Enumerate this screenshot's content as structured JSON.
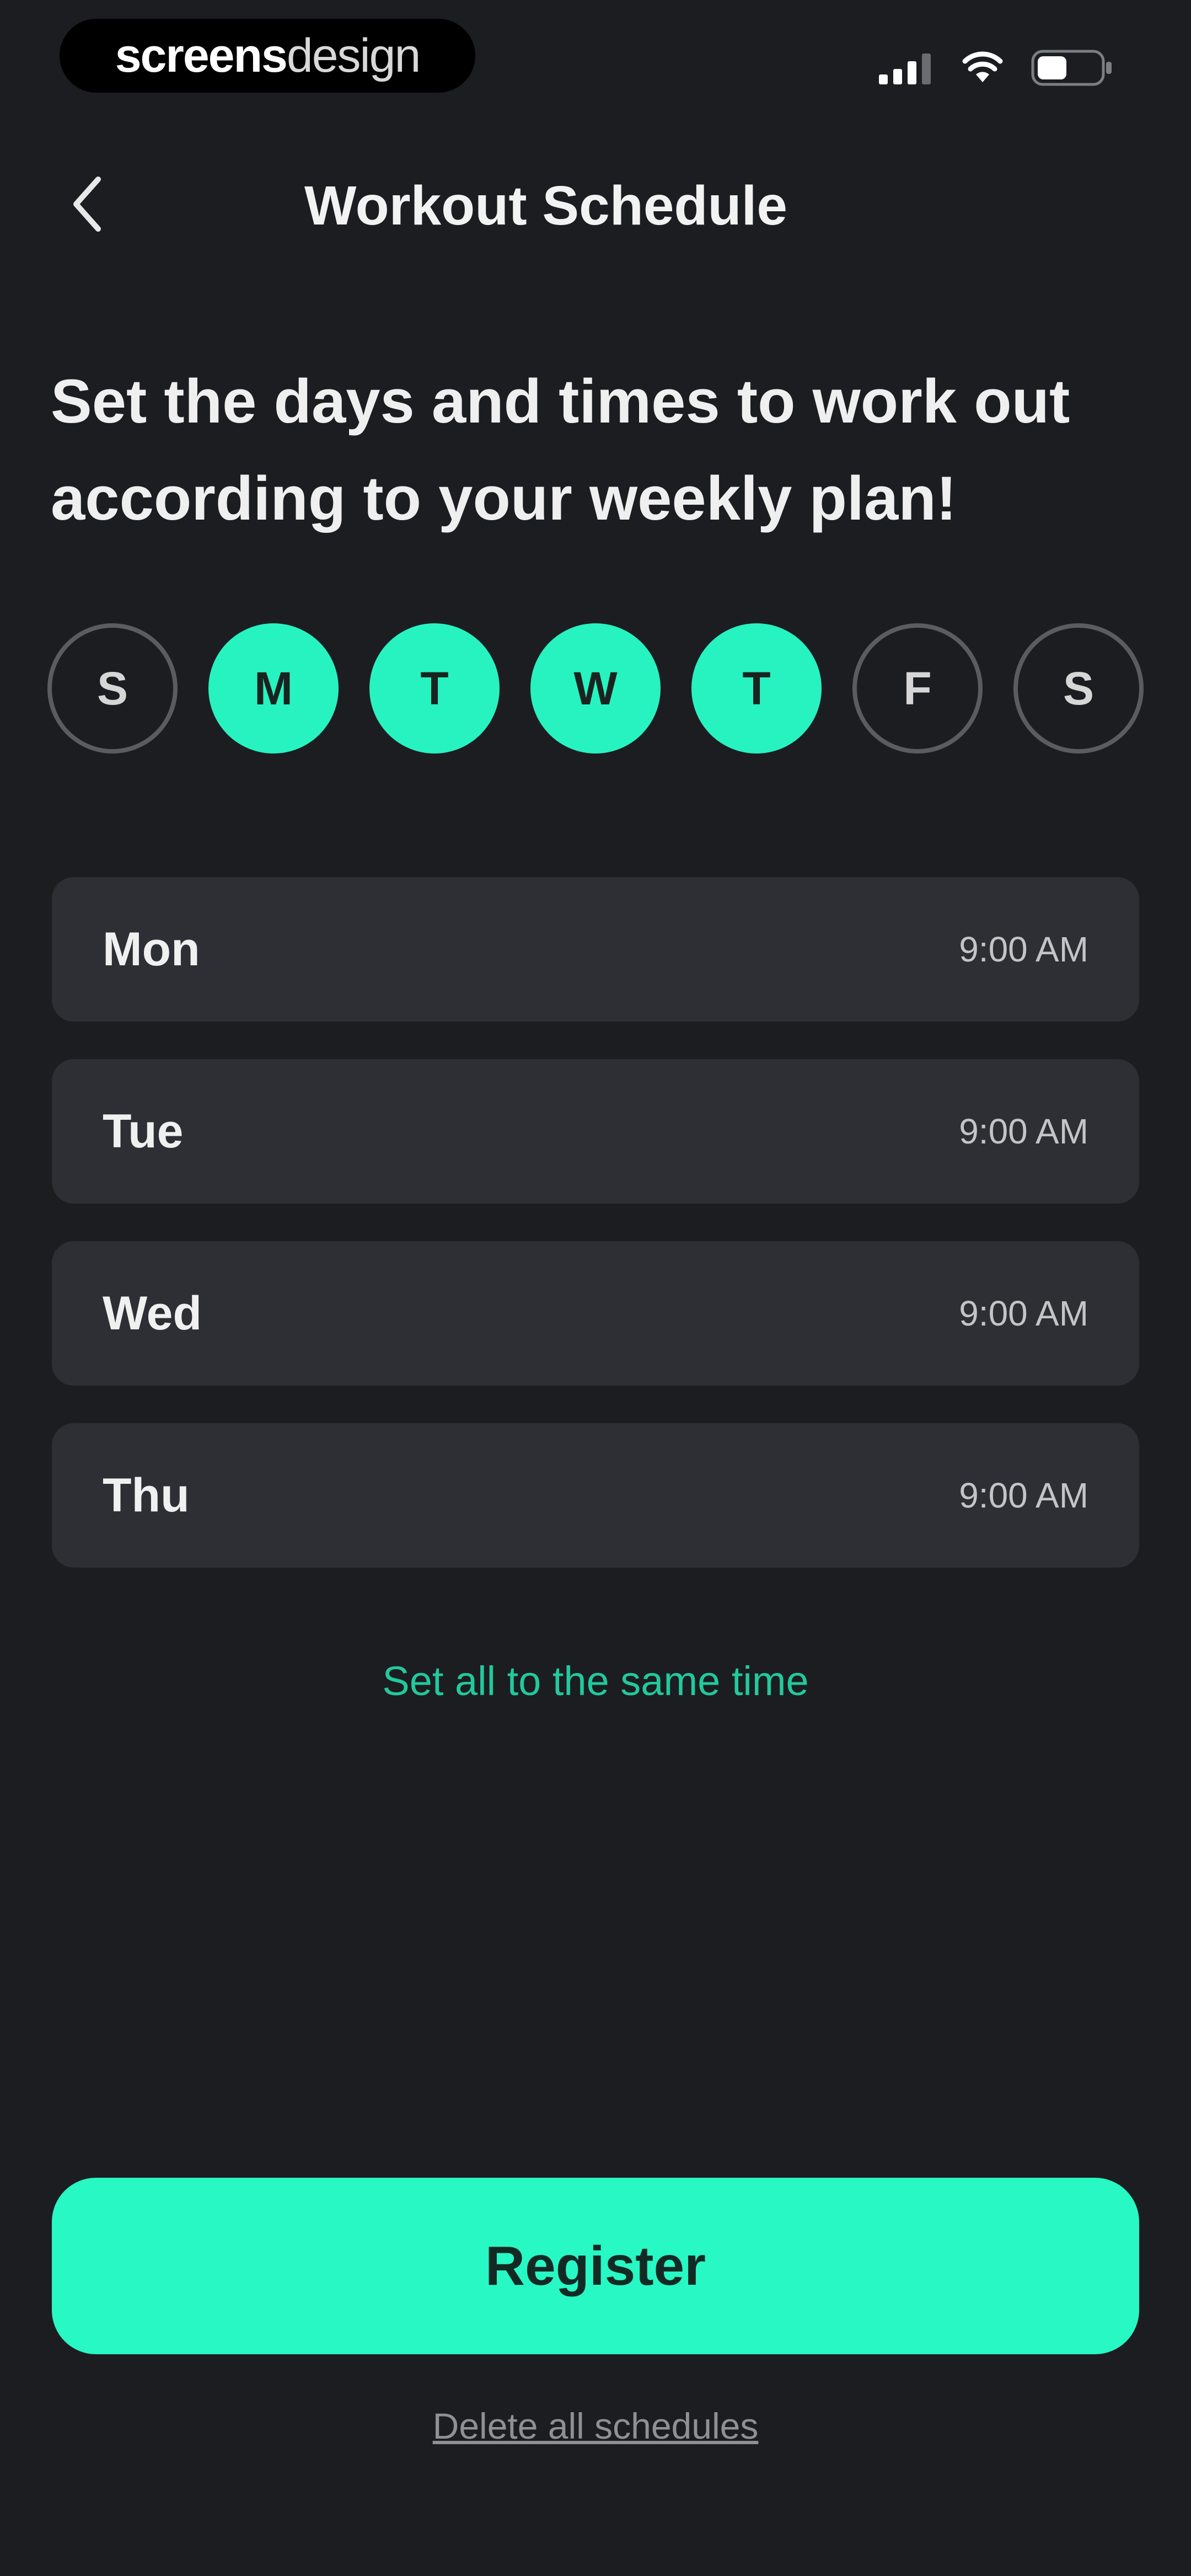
{
  "status_bar": {
    "brand_bold": "screens",
    "brand_light": "design",
    "icons": [
      "signal-icon",
      "wifi-icon",
      "battery-icon"
    ]
  },
  "header": {
    "title": "Workout Schedule",
    "back_icon": "chevron-left-icon"
  },
  "headline": "Set the days and times to work out according to your weekly plan!",
  "days": [
    {
      "label": "S",
      "selected": false
    },
    {
      "label": "M",
      "selected": true
    },
    {
      "label": "T",
      "selected": true
    },
    {
      "label": "W",
      "selected": true
    },
    {
      "label": "T",
      "selected": true
    },
    {
      "label": "F",
      "selected": false
    },
    {
      "label": "S",
      "selected": false
    }
  ],
  "schedules": [
    {
      "day": "Mon",
      "time": "9:00 AM"
    },
    {
      "day": "Tue",
      "time": "9:00 AM"
    },
    {
      "day": "Wed",
      "time": "9:00 AM"
    },
    {
      "day": "Thu",
      "time": "9:00 AM"
    }
  ],
  "same_time_link": "Set all to the same time",
  "register_button": "Register",
  "delete_link": "Delete all schedules",
  "colors": {
    "background": "#1c1d21",
    "accent": "#27f3c1",
    "row_background": "#2d2f34",
    "link_accent": "#22c99c"
  }
}
